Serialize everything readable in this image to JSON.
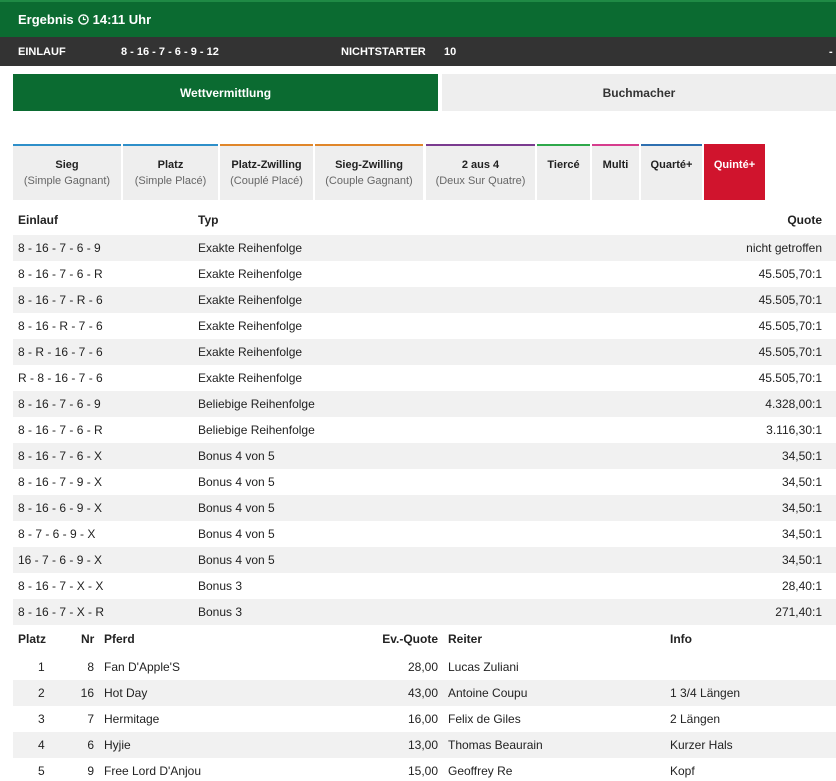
{
  "header": {
    "title": "Ergebnis",
    "time": "14:11 Uhr"
  },
  "info": {
    "einlauf_label": "EINLAUF",
    "einlauf_value": "8 - 16 - 7 - 6 - 9 - 12",
    "nichtstarter_label": "NICHTSTARTER",
    "nichtstarter_value": "10",
    "dash": "-"
  },
  "toggle": {
    "active": "Wettvermittlung",
    "inactive": "Buchmacher"
  },
  "tabs": [
    {
      "main": "Sieg",
      "sub": "(Simple Gagnant)",
      "color": "#2e8fc9"
    },
    {
      "main": "Platz",
      "sub": "(Simple Placé)",
      "color": "#2e8fc9"
    },
    {
      "main": "Platz-Zwilling",
      "sub": "(Couplé Placé)",
      "color": "#e0862a"
    },
    {
      "main": "Sieg-Zwilling",
      "sub": "(Couple Gagnant)",
      "color": "#e0862a"
    },
    {
      "main": "2 aus 4",
      "sub": "(Deux Sur Quatre)",
      "color": "#7a3b8f"
    },
    {
      "main": "Tiercé",
      "sub": "",
      "color": "#2ea84a"
    },
    {
      "main": "Multi",
      "sub": "",
      "color": "#d63c8d"
    },
    {
      "main": "Quarté+",
      "sub": "",
      "color": "#2e6fb0"
    },
    {
      "main": "Quinté+",
      "sub": "",
      "color": "#d0142d"
    }
  ],
  "quote_table": {
    "headers": {
      "einlauf": "Einlauf",
      "typ": "Typ",
      "quote": "Quote"
    },
    "rows": [
      {
        "einlauf": "8 - 16 - 7 - 6 - 9",
        "typ": "Exakte Reihenfolge",
        "quote": "nicht getroffen"
      },
      {
        "einlauf": "8 - 16 - 7 - 6 - R",
        "typ": "Exakte Reihenfolge",
        "quote": "45.505,70:1"
      },
      {
        "einlauf": "8 - 16 - 7 - R - 6",
        "typ": "Exakte Reihenfolge",
        "quote": "45.505,70:1"
      },
      {
        "einlauf": "8 - 16 - R - 7 - 6",
        "typ": "Exakte Reihenfolge",
        "quote": "45.505,70:1"
      },
      {
        "einlauf": "8 - R - 16 - 7 - 6",
        "typ": "Exakte Reihenfolge",
        "quote": "45.505,70:1"
      },
      {
        "einlauf": "R - 8 - 16 - 7 - 6",
        "typ": "Exakte Reihenfolge",
        "quote": "45.505,70:1"
      },
      {
        "einlauf": "8 - 16 - 7 - 6 - 9",
        "typ": "Beliebige Reihenfolge",
        "quote": "4.328,00:1"
      },
      {
        "einlauf": "8 - 16 - 7 - 6 - R",
        "typ": "Beliebige Reihenfolge",
        "quote": "3.116,30:1"
      },
      {
        "einlauf": "8 - 16 - 7 - 6 - X",
        "typ": "Bonus 4 von 5",
        "quote": "34,50:1"
      },
      {
        "einlauf": "8 - 16 - 7 - 9 - X",
        "typ": "Bonus 4 von 5",
        "quote": "34,50:1"
      },
      {
        "einlauf": "8 - 16 - 6 - 9 - X",
        "typ": "Bonus 4 von 5",
        "quote": "34,50:1"
      },
      {
        "einlauf": "8 - 7 - 6 - 9 - X",
        "typ": "Bonus 4 von 5",
        "quote": "34,50:1"
      },
      {
        "einlauf": "16 - 7 - 6 - 9 - X",
        "typ": "Bonus 4 von 5",
        "quote": "34,50:1"
      },
      {
        "einlauf": "8 - 16 - 7 - X - X",
        "typ": "Bonus 3",
        "quote": "28,40:1"
      },
      {
        "einlauf": "8 - 16 - 7 - X - R",
        "typ": "Bonus 3",
        "quote": "271,40:1"
      }
    ]
  },
  "result_table": {
    "headers": {
      "platz": "Platz",
      "nr": "Nr",
      "pferd": "Pferd",
      "quote": "Ev.-Quote",
      "reiter": "Reiter",
      "info": "Info"
    },
    "rows": [
      {
        "platz": "1",
        "nr": "8",
        "pferd": "Fan D'Apple'S",
        "quote": "28,00",
        "reiter": "Lucas Zuliani",
        "info": ""
      },
      {
        "platz": "2",
        "nr": "16",
        "pferd": "Hot Day",
        "quote": "43,00",
        "reiter": "Antoine Coupu",
        "info": "1 3/4 Längen"
      },
      {
        "platz": "3",
        "nr": "7",
        "pferd": "Hermitage",
        "quote": "16,00",
        "reiter": "Felix de Giles",
        "info": "2 Längen"
      },
      {
        "platz": "4",
        "nr": "6",
        "pferd": "Hyjie",
        "quote": "13,00",
        "reiter": "Thomas Beaurain",
        "info": "Kurzer Hals"
      },
      {
        "platz": "5",
        "nr": "9",
        "pferd": "Free Lord D'Anjou",
        "quote": "15,00",
        "reiter": "Geoffrey Re",
        "info": "Kopf"
      }
    ]
  }
}
